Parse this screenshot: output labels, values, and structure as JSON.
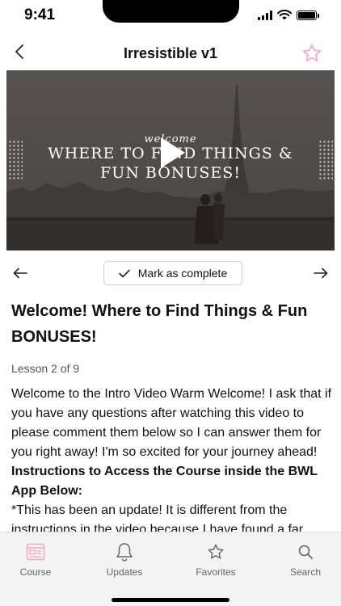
{
  "status": {
    "time": "9:41"
  },
  "header": {
    "title": "Irresistible v1"
  },
  "video": {
    "small_text": "welcome",
    "line1": "WHERE TO FIND THINGS &",
    "line2": "FUN BONUSES!"
  },
  "nav": {
    "complete_label": "Mark as complete"
  },
  "lesson": {
    "title": "Welcome! Where to Find Things & Fun BONUSES!",
    "count": "Lesson 2 of 9",
    "paragraph1": "Welcome to the Intro Video Warm Welcome! I ask that if you have any questions after watching this video to please comment them below so I can answer them for you right away! I'm so excited for your journey ahead!",
    "bold_heading": "Instructions to Access the Course inside the BWL App Below:",
    "paragraph2": "*This has been an update! It is different from the instructions in the video because I have found a far"
  },
  "tabs": [
    {
      "label": "Course",
      "icon": "course-icon"
    },
    {
      "label": "Updates",
      "icon": "bell-icon"
    },
    {
      "label": "Favorites",
      "icon": "star-icon"
    },
    {
      "label": "Search",
      "icon": "search-icon"
    }
  ],
  "colors": {
    "accent_pink": "#f4a6c3",
    "tab_active": "#f4a6c3",
    "tab_inactive": "#666666"
  }
}
